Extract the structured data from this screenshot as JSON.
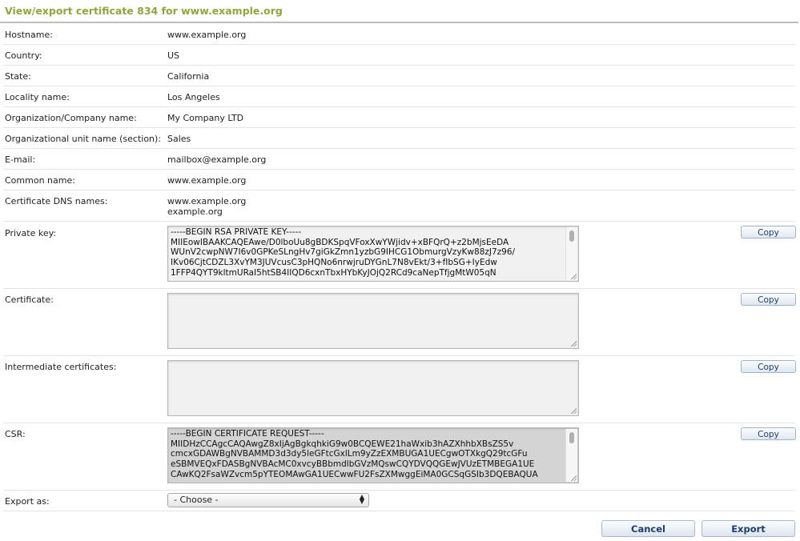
{
  "page": {
    "title": "View/export certificate 834 for www.example.org"
  },
  "fields": {
    "hostname": {
      "label": "Hostname:",
      "value": "www.example.org"
    },
    "country": {
      "label": "Country:",
      "value": "US"
    },
    "state": {
      "label": "State:",
      "value": "California"
    },
    "locality": {
      "label": "Locality name:",
      "value": "Los Angeles"
    },
    "organization": {
      "label": "Organization/Company name:",
      "value": "My Company LTD"
    },
    "org_unit": {
      "label": "Organizational unit name (section):",
      "value": "Sales"
    },
    "email": {
      "label": "E-mail:",
      "value": "mailbox@example.org"
    },
    "common_name": {
      "label": "Common name:",
      "value": "www.example.org"
    },
    "dns_names": {
      "label": "Certificate DNS names:",
      "values": [
        "www.example.org",
        "example.org"
      ]
    }
  },
  "private_key": {
    "label": "Private key:",
    "value": "-----BEGIN RSA PRIVATE KEY-----\nMIIEowIBAAKCAQEAwe/D0lboUu8gBDKSpqVFoxXwYWjidv+xBFQrQ+z2bMjsEeDA\nWUnV2cwpNW7I6v0GPKeSLngHv7giGkZmn1yzbG9IHCG1ObmurgVzyKw88zJ7z96/\nIKv06CjtCDZL3XvYM3JUVcusC3pHQNo6nrwjruDYGnL7N8vEkt/3+fIbSG+IyEdw\n1FFP4QYT9kltmURaI5htSB4IIQD6cxnTbxHYbKyJOjQ2RCd9caNepTfjgMtW05qN",
    "copy_label": "Copy"
  },
  "certificate": {
    "label": "Certificate:",
    "value": "",
    "copy_label": "Copy"
  },
  "intermediate": {
    "label": "Intermediate certificates:",
    "value": "",
    "copy_label": "Copy"
  },
  "csr": {
    "label": "CSR:",
    "value": "-----BEGIN CERTIFICATE REQUEST-----\nMIIDHzCCAgcCAQAwgZ8xIjAgBgkqhkiG9w0BCQEWE21haWxib3hAZXhhbXBsZS5v\ncmcxGDAWBgNVBAMMD3d3dy5leGFtcGxlLm9yZzEXMBUGA1UECgwOTXkgQ29tcGFu\neSBMVEQxFDASBgNVBAcMC0xvcyBBbmdlbGVzMQswCQYDVQQGEwJVUzETMBEGA1UE\nCAwKQ2FsaWZvcm5pYTEOMAwGA1UECwwFU2FsZXMwggEiMA0GCSqGSIb3DQEBAQUA",
    "copy_label": "Copy"
  },
  "export_as": {
    "label": "Export as:",
    "selected": "- Choose -"
  },
  "buttons": {
    "cancel": "Cancel",
    "export": "Export"
  }
}
